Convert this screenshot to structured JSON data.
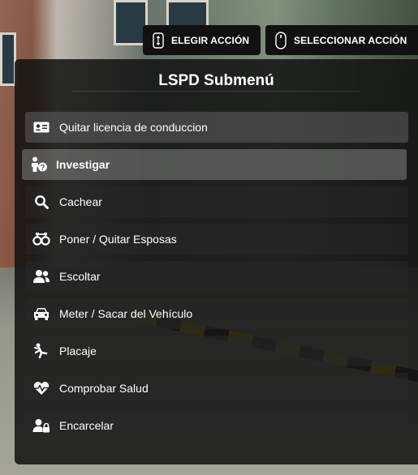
{
  "hints": {
    "elegir": {
      "icon": "arrows-updown-icon",
      "label": "ELEGIR ACCIÓN"
    },
    "seleccionar": {
      "icon": "mouse-icon",
      "label": "SELECCIONAR ACCIÓN"
    }
  },
  "menu": {
    "title": "LSPD Submenú",
    "items": [
      {
        "icon": "id-card-icon",
        "label": "Quitar licencia de conduccion"
      },
      {
        "icon": "person-question-icon",
        "label": "Investigar"
      },
      {
        "icon": "search-icon",
        "label": "Cachear"
      },
      {
        "icon": "handcuffs-icon",
        "label": "Poner / Quitar Esposas"
      },
      {
        "icon": "users-icon",
        "label": "Escoltar"
      },
      {
        "icon": "car-icon",
        "label": "Meter / Sacar del Vehículo"
      },
      {
        "icon": "tackle-icon",
        "label": "Placaje"
      },
      {
        "icon": "heartbeat-icon",
        "label": "Comprobar Salud"
      },
      {
        "icon": "user-lock-icon",
        "label": "Encarcelar"
      }
    ],
    "selected_index": 1
  }
}
